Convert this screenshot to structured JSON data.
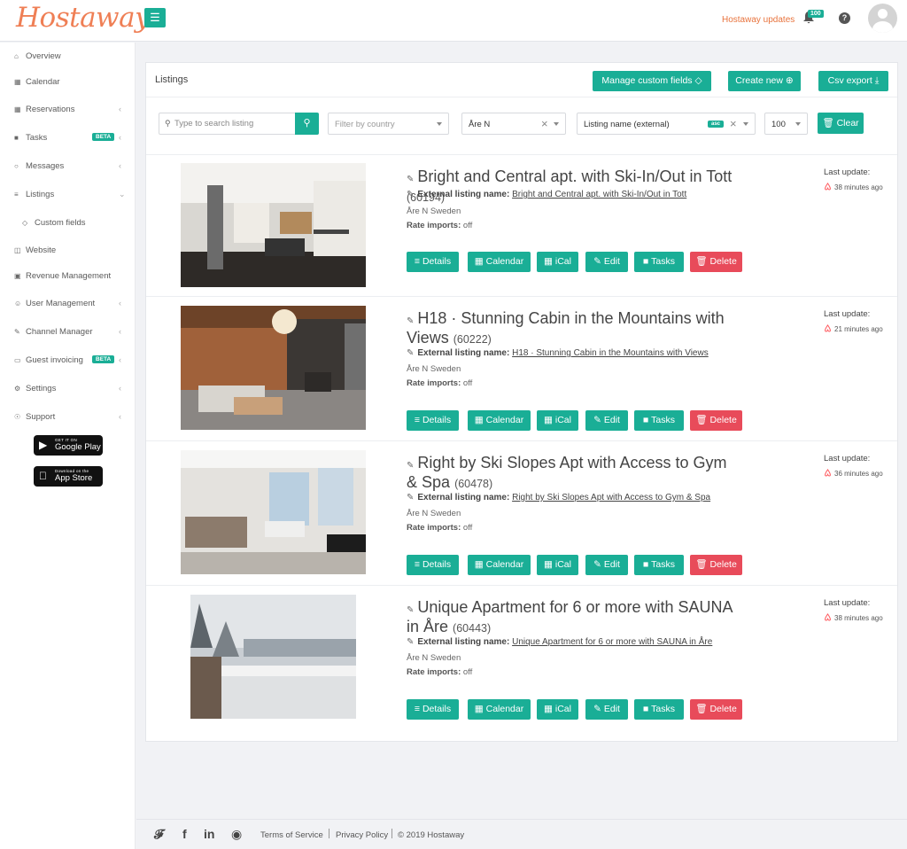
{
  "header": {
    "logo": "Hostaway",
    "menu_icon": "hamburger-icon",
    "updates_label": "Hostaway updates",
    "notification_count": "100",
    "help_label": "?"
  },
  "sidebar": {
    "items": [
      {
        "label": "Overview",
        "icon": "home-icon"
      },
      {
        "label": "Calendar",
        "icon": "calendar-icon"
      },
      {
        "label": "Reservations",
        "icon": "reservations-icon"
      },
      {
        "label": "Tasks",
        "icon": "tasks-icon",
        "badge": "BETA"
      },
      {
        "label": "Messages",
        "icon": "messages-icon"
      },
      {
        "label": "Listings",
        "icon": "list-icon"
      },
      {
        "label": "Custom fields",
        "icon": "diamond-icon"
      },
      {
        "label": "Website",
        "icon": "website-icon"
      },
      {
        "label": "Revenue Management",
        "icon": "revenue-icon"
      },
      {
        "label": "User Management",
        "icon": "user-icon"
      },
      {
        "label": "Channel Manager",
        "icon": "channel-icon"
      },
      {
        "label": "Guest invoicing",
        "icon": "invoice-icon",
        "badge": "BETA"
      },
      {
        "label": "Settings",
        "icon": "settings-icon"
      },
      {
        "label": "Support",
        "icon": "support-icon"
      }
    ],
    "google_play_small": "GET IT ON",
    "google_play_big": "Google Play",
    "app_store_small": "Download on the",
    "app_store_big": "App Store"
  },
  "panel": {
    "title": "Listings",
    "manage_custom_fields": "Manage custom fields",
    "create_new": "Create new",
    "csv_export": "Csv export",
    "search_placeholder": "Type to search listing",
    "country_placeholder": "Filter by country",
    "city_value": "Åre N",
    "sort_value": "Listing name (external)",
    "sort_order": "asc",
    "page_size": "100",
    "clear_label": "Clear"
  },
  "row_labels": {
    "external_label": "External listing name:",
    "rate_label": "Rate imports:",
    "last_update_label": "Last update:",
    "details": "Details",
    "calendar": "Calendar",
    "ical": "iCal",
    "edit": "Edit",
    "tasks": "Tasks",
    "delete": "Delete"
  },
  "listings": [
    {
      "name": "Bright and Central apt. with Ski-In/Out in Tott",
      "id": "(60194)",
      "external_name": "Bright and Central apt. with Ski-In/Out in Tott",
      "location": "Åre N Sweden",
      "rate_imports": "off",
      "last_update": "38 minutes ago"
    },
    {
      "name": "H18 · Stunning Cabin in the Mountains with Views",
      "id": "(60222)",
      "external_name": "H18 · Stunning Cabin in the Mountains with Views",
      "location": "Åre N Sweden",
      "rate_imports": "off",
      "last_update": "21 minutes ago"
    },
    {
      "name": "Right by Ski Slopes Apt with Access to Gym & Spa",
      "id": "(60478)",
      "external_name": "Right by Ski Slopes Apt with Access to Gym & Spa",
      "location": "Åre N Sweden",
      "rate_imports": "off",
      "last_update": "36 minutes ago"
    },
    {
      "name": "Unique Apartment for 6 or more with SAUNA in Åre",
      "id": "(60443)",
      "external_name": "Unique Apartment for 6 or more with SAUNA in Åre",
      "location": "Åre N Sweden",
      "rate_imports": "off",
      "last_update": "38 minutes ago"
    }
  ],
  "footer": {
    "terms": "Terms of Service",
    "privacy": "Privacy Policy",
    "copyright": "© 2019 Hostaway"
  },
  "colors": {
    "accent": "#1aae96",
    "danger": "#e84b5a",
    "brand": "#ef7f55",
    "airbnb": "#ff5a5f"
  }
}
